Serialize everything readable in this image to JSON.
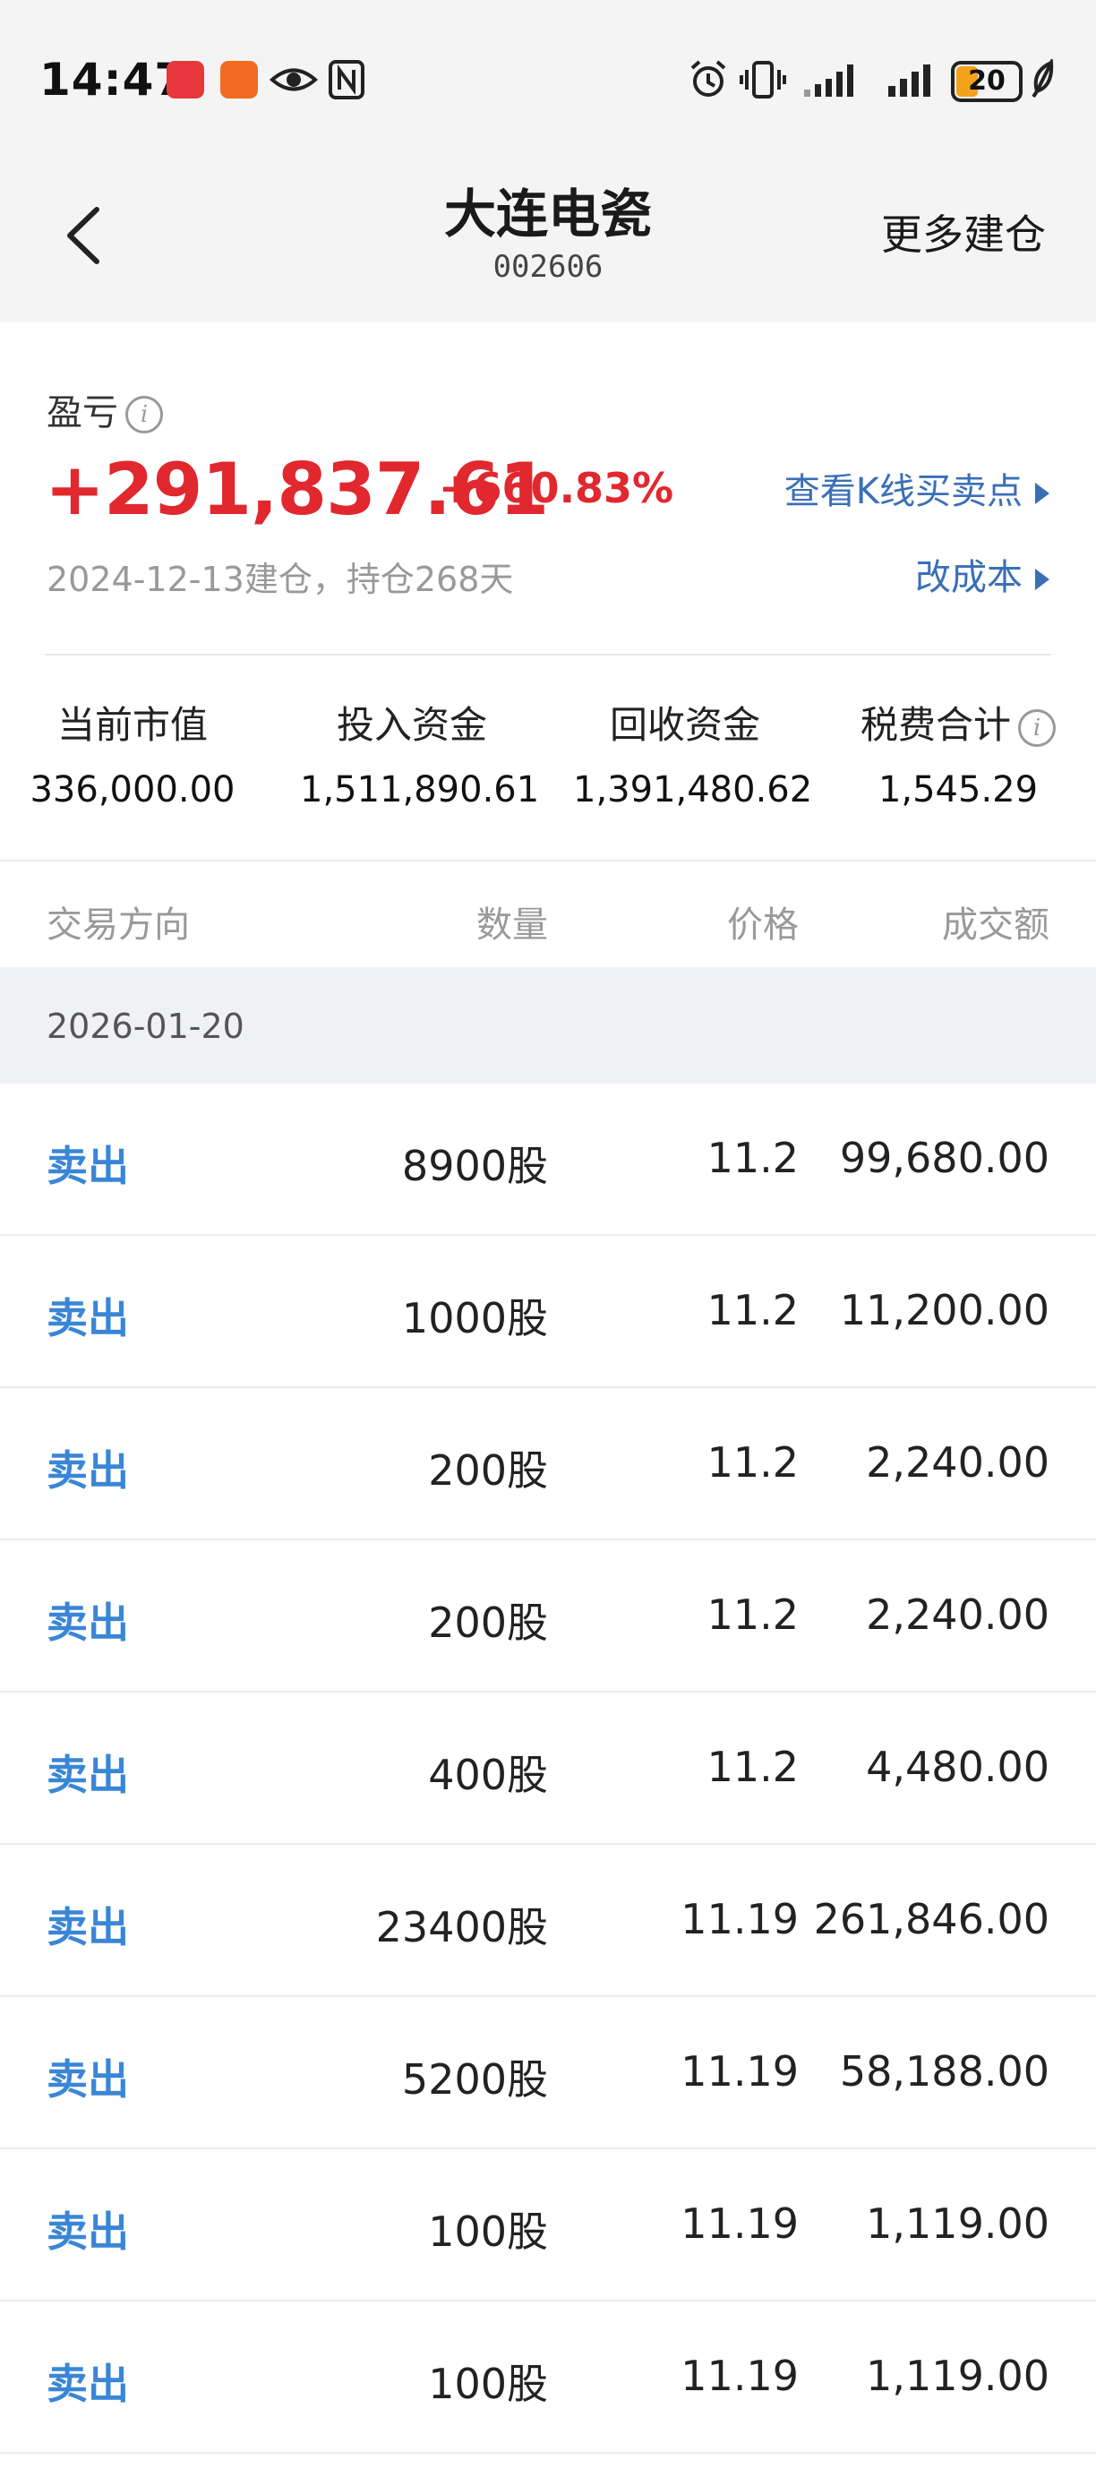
{
  "status_bar": {
    "time": "14:47",
    "battery": "20"
  },
  "nav": {
    "title": "大连电瓷",
    "code": "002606",
    "action": "更多建仓"
  },
  "summary": {
    "pl_label": "盈亏",
    "pl_value": "+291,837.61",
    "pl_pct": "+660.83%",
    "kline_link": "查看K线买卖点",
    "open_info": "2024-12-13建仓，持仓268天",
    "cost_link": "改成本",
    "stats": [
      {
        "label": "当前市值",
        "value": "336,000.00"
      },
      {
        "label": "投入资金",
        "value": "1,511,890.61"
      },
      {
        "label": "回收资金",
        "value": "1,391,480.62"
      },
      {
        "label": "税费合计",
        "value": "1,545.29"
      }
    ]
  },
  "table": {
    "headers": {
      "direction": "交易方向",
      "quantity": "数量",
      "price": "价格",
      "amount": "成交额"
    },
    "date": "2026-01-20",
    "rows": [
      {
        "direction": "卖出",
        "quantity": "8900股",
        "price": "11.2",
        "amount": "99,680.00"
      },
      {
        "direction": "卖出",
        "quantity": "1000股",
        "price": "11.2",
        "amount": "11,200.00"
      },
      {
        "direction": "卖出",
        "quantity": "200股",
        "price": "11.2",
        "amount": "2,240.00"
      },
      {
        "direction": "卖出",
        "quantity": "200股",
        "price": "11.2",
        "amount": "2,240.00"
      },
      {
        "direction": "卖出",
        "quantity": "400股",
        "price": "11.2",
        "amount": "4,480.00"
      },
      {
        "direction": "卖出",
        "quantity": "23400股",
        "price": "11.19",
        "amount": "261,846.00"
      },
      {
        "direction": "卖出",
        "quantity": "5200股",
        "price": "11.19",
        "amount": "58,188.00"
      },
      {
        "direction": "卖出",
        "quantity": "100股",
        "price": "11.19",
        "amount": "1,119.00"
      },
      {
        "direction": "卖出",
        "quantity": "100股",
        "price": "11.19",
        "amount": "1,119.00"
      }
    ]
  },
  "colors": {
    "profit_red": "#e0282e",
    "link_blue": "#3a6fb7",
    "sell_blue": "#3a86d6",
    "header_bg": "#f4f4f4"
  }
}
